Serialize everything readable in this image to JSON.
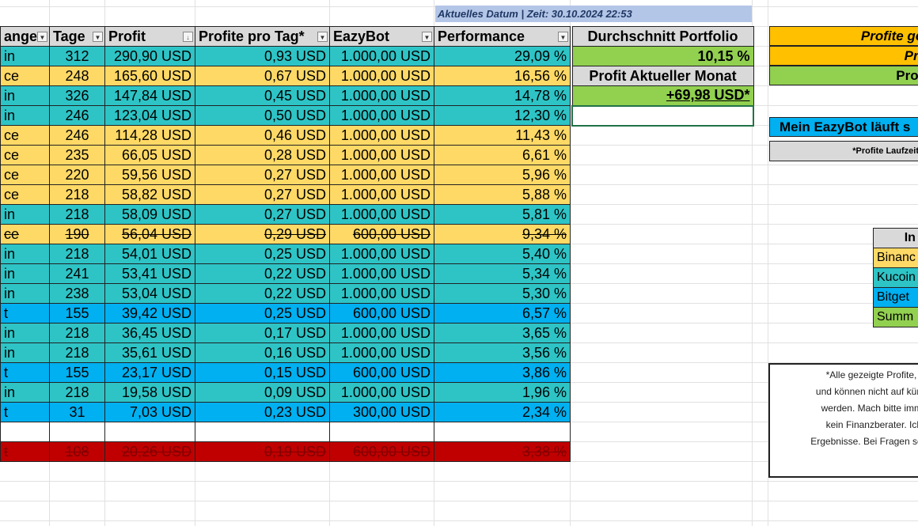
{
  "date_label": "Aktuelles Datum | Zeit:  30.10.2024 22:53",
  "headers": [
    "ange",
    "Tage",
    "Profit",
    "Profite pro Tag*",
    "EazyBot",
    "Performance"
  ],
  "rows": [
    {
      "exchange": "in",
      "type": "kucoin",
      "days": "312",
      "profit": "290,90 USD",
      "ppd": "0,93 USD",
      "bot": "1.000,00 USD",
      "perf": "29,09 %"
    },
    {
      "exchange": "ce",
      "type": "binance",
      "days": "248",
      "profit": "165,60 USD",
      "ppd": "0,67 USD",
      "bot": "1.000,00 USD",
      "perf": "16,56 %"
    },
    {
      "exchange": "in",
      "type": "kucoin",
      "days": "326",
      "profit": "147,84 USD",
      "ppd": "0,45 USD",
      "bot": "1.000,00 USD",
      "perf": "14,78 %"
    },
    {
      "exchange": "in",
      "type": "kucoin",
      "days": "246",
      "profit": "123,04 USD",
      "ppd": "0,50 USD",
      "bot": "1.000,00 USD",
      "perf": "12,30 %"
    },
    {
      "exchange": "ce",
      "type": "binance",
      "days": "246",
      "profit": "114,28 USD",
      "ppd": "0,46 USD",
      "bot": "1.000,00 USD",
      "perf": "11,43 %"
    },
    {
      "exchange": "ce",
      "type": "binance",
      "days": "235",
      "profit": "66,05 USD",
      "ppd": "0,28 USD",
      "bot": "1.000,00 USD",
      "perf": "6,61 %"
    },
    {
      "exchange": "ce",
      "type": "binance",
      "days": "220",
      "profit": "59,56 USD",
      "ppd": "0,27 USD",
      "bot": "1.000,00 USD",
      "perf": "5,96 %"
    },
    {
      "exchange": "ce",
      "type": "binance",
      "days": "218",
      "profit": "58,82 USD",
      "ppd": "0,27 USD",
      "bot": "1.000,00 USD",
      "perf": "5,88 %"
    },
    {
      "exchange": "in",
      "type": "kucoin",
      "days": "218",
      "profit": "58,09 USD",
      "ppd": "0,27 USD",
      "bot": "1.000,00 USD",
      "perf": "5,81 %"
    },
    {
      "exchange": "ce",
      "type": "binance strike",
      "days": "190",
      "profit": "56,04 USD",
      "ppd": "0,29 USD",
      "bot": "600,00 USD",
      "perf": "9,34 %"
    },
    {
      "exchange": "in",
      "type": "kucoin",
      "days": "218",
      "profit": "54,01 USD",
      "ppd": "0,25 USD",
      "bot": "1.000,00 USD",
      "perf": "5,40 %"
    },
    {
      "exchange": "in",
      "type": "kucoin",
      "days": "241",
      "profit": "53,41 USD",
      "ppd": "0,22 USD",
      "bot": "1.000,00 USD",
      "perf": "5,34 %"
    },
    {
      "exchange": "in",
      "type": "kucoin",
      "days": "238",
      "profit": "53,04 USD",
      "ppd": "0,22 USD",
      "bot": "1.000,00 USD",
      "perf": "5,30 %"
    },
    {
      "exchange": "t",
      "type": "bitget",
      "days": "155",
      "profit": "39,42 USD",
      "ppd": "0,25 USD",
      "bot": "600,00 USD",
      "perf": "6,57 %"
    },
    {
      "exchange": "in",
      "type": "kucoin",
      "days": "218",
      "profit": "36,45 USD",
      "ppd": "0,17 USD",
      "bot": "1.000,00 USD",
      "perf": "3,65 %"
    },
    {
      "exchange": "in",
      "type": "kucoin",
      "days": "218",
      "profit": "35,61 USD",
      "ppd": "0,16 USD",
      "bot": "1.000,00 USD",
      "perf": "3,56 %"
    },
    {
      "exchange": "t",
      "type": "bitget",
      "days": "155",
      "profit": "23,17 USD",
      "ppd": "0,15 USD",
      "bot": "600,00 USD",
      "perf": "3,86 %"
    },
    {
      "exchange": "in",
      "type": "kucoin",
      "days": "218",
      "profit": "19,58 USD",
      "ppd": "0,09 USD",
      "bot": "1.000,00 USD",
      "perf": "1,96 %"
    },
    {
      "exchange": "t",
      "type": "bitget",
      "days": "31",
      "profit": "7,03 USD",
      "ppd": "0,23 USD",
      "bot": "300,00 USD",
      "perf": "2,34 %"
    },
    {
      "exchange": "",
      "type": "empty",
      "days": "",
      "profit": "",
      "ppd": "",
      "bot": "",
      "perf": ""
    },
    {
      "exchange": "t",
      "type": "red strike",
      "days": "108",
      "profit": "20,26 USD",
      "ppd": "0,19 USD",
      "bot": "600,00 USD",
      "perf": "3,38 %"
    }
  ],
  "side": {
    "avg_label": "Durchschnitt Portfolio",
    "avg_value": "10,15 %",
    "month_label": "Profit Aktueller Monat",
    "month_value": "+69,98 USD*"
  },
  "right": {
    "box1": "Profite gel",
    "box2": "Pro",
    "box3": "Profi",
    "box4": "Mein EazyBot läuft s",
    "box5": "*Profite Laufzeit"
  },
  "mini": {
    "header": "In",
    "items": [
      "Binanc",
      "Kucoin",
      "Bitget",
      "Summ"
    ],
    "colors": [
      "#ffd966",
      "#2ec4c6",
      "#00b0f0",
      "#92d050"
    ]
  },
  "disclaimer": [
    "*Alle gezeigte Profite, I",
    "und können nicht auf kün",
    "werden. Mach bitte imm",
    "kein Finanzberater. Ich",
    "Ergebnisse. Bei Fragen sc"
  ]
}
